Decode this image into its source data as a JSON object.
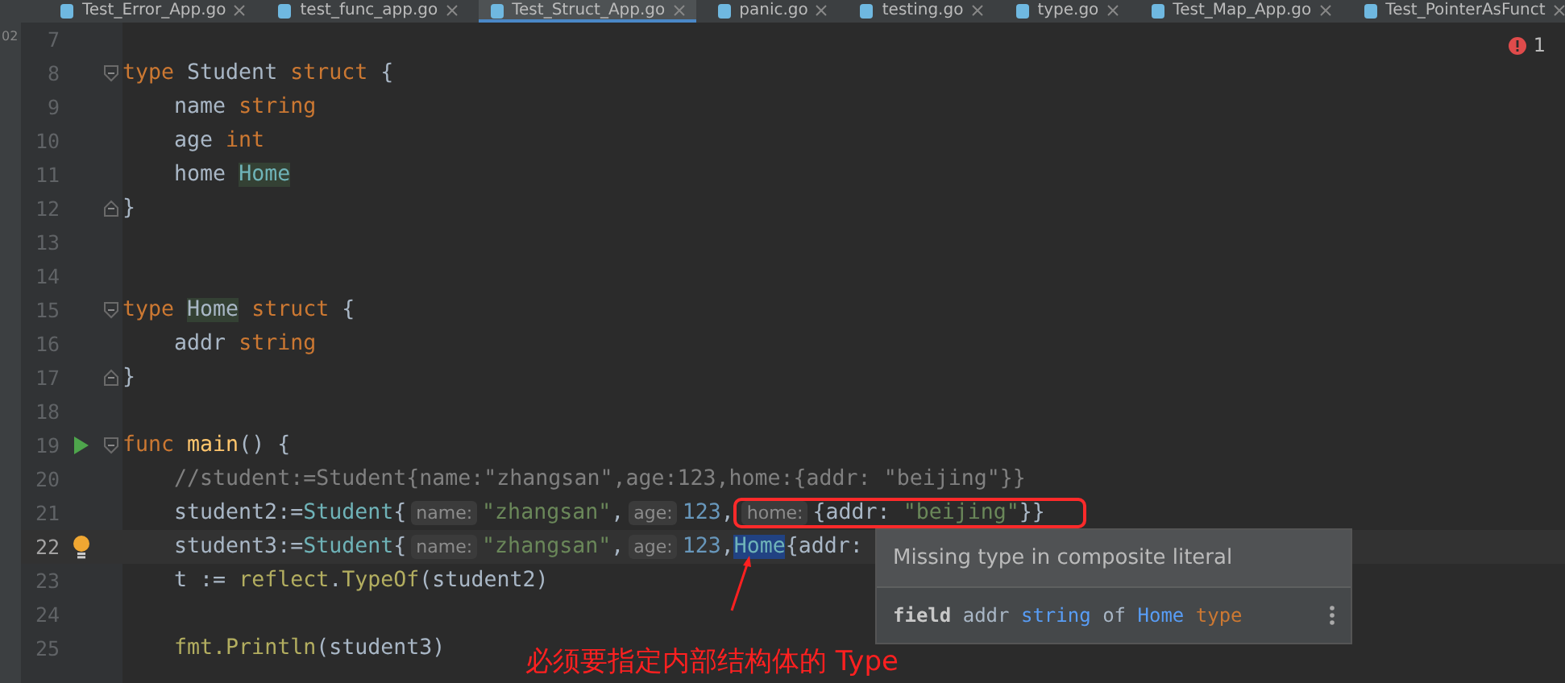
{
  "side_text": "02",
  "tabs": [
    {
      "label": "Test_Error_App.go",
      "selected": false
    },
    {
      "label": "test_func_app.go",
      "selected": false
    },
    {
      "label": "Test_Struct_App.go",
      "selected": true
    },
    {
      "label": "panic.go",
      "selected": false
    },
    {
      "label": "testing.go",
      "selected": false
    },
    {
      "label": "type.go",
      "selected": false
    },
    {
      "label": "Test_Map_App.go",
      "selected": false
    },
    {
      "label": "Test_PointerAsFunct",
      "selected": false
    }
  ],
  "error_count": "1",
  "lines": [
    {
      "number": "7",
      "current": false,
      "fold_start": false,
      "fold_end": false,
      "run": false,
      "bulb": false
    },
    {
      "number": "8",
      "current": false,
      "fold_start": true,
      "fold_end": false,
      "run": false,
      "bulb": false,
      "tokens": [
        {
          "kind": "keyword",
          "text": "type "
        },
        {
          "kind": "plain",
          "text": "Student "
        },
        {
          "kind": "keyword",
          "text": "struct "
        },
        {
          "kind": "plain",
          "text": "{"
        }
      ]
    },
    {
      "number": "9",
      "current": false,
      "fold_start": false,
      "fold_end": false,
      "run": false,
      "bulb": false,
      "tokens": [
        {
          "kind": "plain",
          "text": "    name "
        },
        {
          "kind": "keyword",
          "text": "string"
        }
      ]
    },
    {
      "number": "10",
      "current": false,
      "fold_start": false,
      "fold_end": false,
      "run": false,
      "bulb": false,
      "tokens": [
        {
          "kind": "plain",
          "text": "    age "
        },
        {
          "kind": "keyword",
          "text": "int"
        }
      ]
    },
    {
      "number": "11",
      "current": false,
      "fold_start": false,
      "fold_end": false,
      "run": false,
      "bulb": false,
      "tokens": [
        {
          "kind": "plain",
          "text": "    home "
        },
        {
          "kind": "usage",
          "text": "Home"
        }
      ]
    },
    {
      "number": "12",
      "current": false,
      "fold_start": false,
      "fold_end": true,
      "run": false,
      "bulb": false,
      "tokens": [
        {
          "kind": "plain",
          "text": "}"
        }
      ]
    },
    {
      "number": "13",
      "current": false,
      "fold_start": false,
      "fold_end": false,
      "run": false,
      "bulb": false
    },
    {
      "number": "14",
      "current": false,
      "fold_start": false,
      "fold_end": false,
      "run": false,
      "bulb": false
    },
    {
      "number": "15",
      "current": false,
      "fold_start": true,
      "fold_end": false,
      "run": false,
      "bulb": false,
      "tokens": [
        {
          "kind": "keyword",
          "text": "type "
        },
        {
          "kind": "usage-plain",
          "text": "Home"
        },
        {
          "kind": "keyword",
          "text": " struct "
        },
        {
          "kind": "plain",
          "text": "{"
        }
      ]
    },
    {
      "number": "16",
      "current": false,
      "fold_start": false,
      "fold_end": false,
      "run": false,
      "bulb": false,
      "tokens": [
        {
          "kind": "plain",
          "text": "    addr "
        },
        {
          "kind": "keyword",
          "text": "string"
        }
      ]
    },
    {
      "number": "17",
      "current": false,
      "fold_start": false,
      "fold_end": true,
      "run": false,
      "bulb": false,
      "tokens": [
        {
          "kind": "plain",
          "text": "}"
        }
      ]
    },
    {
      "number": "18",
      "current": false,
      "fold_start": false,
      "fold_end": false,
      "run": false,
      "bulb": false
    },
    {
      "number": "19",
      "current": false,
      "fold_start": true,
      "fold_end": false,
      "run": true,
      "bulb": false,
      "tokens": [
        {
          "kind": "keyword",
          "text": "func "
        },
        {
          "kind": "funcdef",
          "text": "main"
        },
        {
          "kind": "plain",
          "text": "() {"
        }
      ]
    },
    {
      "number": "20",
      "current": false,
      "fold_start": false,
      "fold_end": false,
      "run": false,
      "bulb": false,
      "tokens": [
        {
          "kind": "comment",
          "text": "    //student:=Student{name:\"zhangsan\",age:123,home:{addr: \"beijing\"}}"
        }
      ]
    },
    {
      "number": "21",
      "current": false,
      "fold_start": false,
      "fold_end": false,
      "run": false,
      "bulb": false,
      "tokens": [
        {
          "kind": "plain",
          "text": "    student2:="
        },
        {
          "kind": "type",
          "text": "Student"
        },
        {
          "kind": "plain",
          "text": "{"
        },
        {
          "kind": "hint",
          "text": "name:"
        },
        {
          "kind": "string",
          "text": "\"zhangsan\""
        },
        {
          "kind": "plain",
          "text": ","
        },
        {
          "kind": "hint",
          "text": "age:"
        },
        {
          "kind": "number",
          "text": "123"
        },
        {
          "kind": "plain",
          "text": ","
        }
      ],
      "outlined_tokens": [
        {
          "kind": "hint",
          "text": "home:"
        },
        {
          "kind": "plain",
          "text": "{addr: "
        },
        {
          "kind": "string",
          "text": "\"beijing\""
        },
        {
          "kind": "plain",
          "text": "}}"
        }
      ]
    },
    {
      "number": "22",
      "current": true,
      "fold_start": false,
      "fold_end": false,
      "run": false,
      "bulb": true,
      "tokens": [
        {
          "kind": "plain",
          "text": "    student3:="
        },
        {
          "kind": "type",
          "text": "Student"
        },
        {
          "kind": "plain",
          "text": "{"
        },
        {
          "kind": "hint",
          "text": "name:"
        },
        {
          "kind": "string",
          "text": "\"zhangsan\""
        },
        {
          "kind": "plain",
          "text": ","
        },
        {
          "kind": "hint",
          "text": "age:"
        },
        {
          "kind": "number",
          "text": "123"
        },
        {
          "kind": "plain",
          "text": ","
        },
        {
          "kind": "selected",
          "text": "Home"
        },
        {
          "kind": "plain",
          "text": "{addr:"
        }
      ]
    },
    {
      "number": "23",
      "current": false,
      "fold_start": false,
      "fold_end": false,
      "run": false,
      "bulb": false,
      "tokens": [
        {
          "kind": "plain",
          "text": "    t := "
        },
        {
          "kind": "call",
          "text": "reflect"
        },
        {
          "kind": "plain",
          "text": "."
        },
        {
          "kind": "call",
          "text": "TypeOf"
        },
        {
          "kind": "plain",
          "text": "(student2)"
        }
      ]
    },
    {
      "number": "24",
      "current": false,
      "fold_start": false,
      "fold_end": false,
      "run": false,
      "bulb": false
    },
    {
      "number": "25",
      "current": false,
      "fold_start": false,
      "fold_end": false,
      "run": false,
      "bulb": false,
      "tokens": [
        {
          "kind": "call",
          "text": "    fmt."
        },
        {
          "kind": "call",
          "text": "Println"
        },
        {
          "kind": "plain",
          "text": "(student3)"
        }
      ]
    }
  ],
  "tooltip": {
    "title": "Missing type in composite literal",
    "body": [
      {
        "kind": "bold",
        "text": "field"
      },
      {
        "kind": "plain",
        "text": " addr "
      },
      {
        "kind": "ref",
        "text": "string"
      },
      {
        "kind": "plain",
        "text": " of "
      },
      {
        "kind": "ref",
        "text": "Home"
      },
      {
        "kind": "keyword",
        "text": " type"
      }
    ]
  },
  "annotation": "必须要指定内部结构体的 Type"
}
